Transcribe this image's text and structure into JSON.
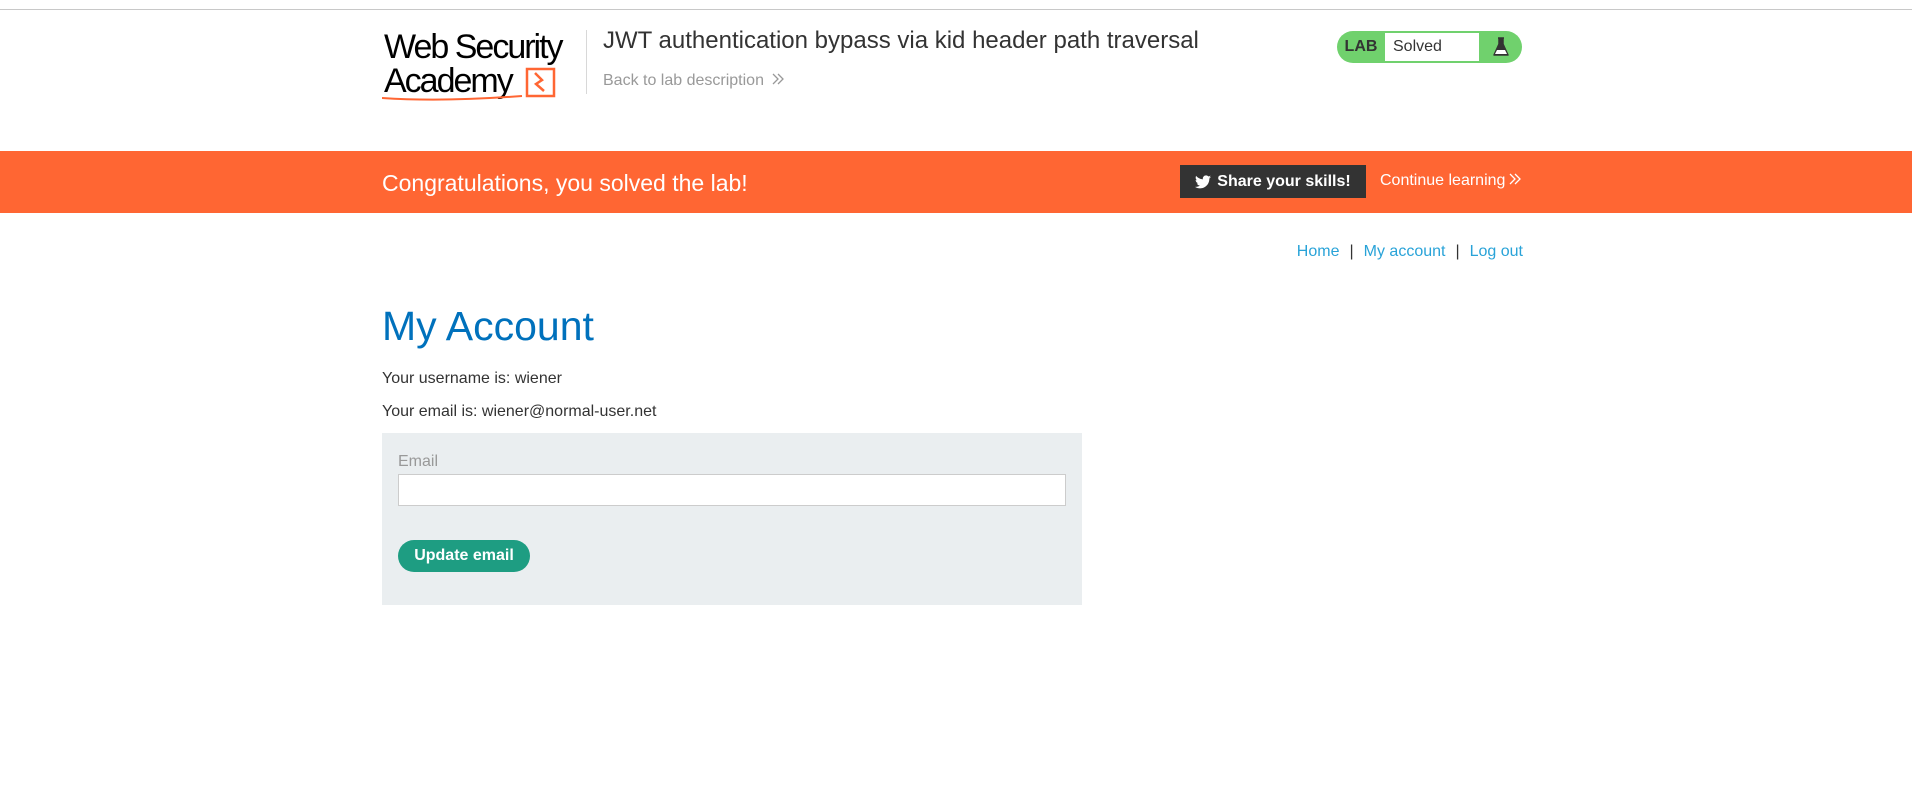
{
  "header": {
    "logo_text_line1": "Web Security",
    "logo_text_line2": "Academy",
    "lab_title": "JWT authentication bypass via kid header path traversal",
    "back_link": "Back to lab description",
    "lab_status": {
      "label": "LAB",
      "state": "Solved",
      "icon": "flask-icon"
    }
  },
  "banner": {
    "message": "Congratulations, you solved the lab!",
    "share_label": "Share your skills!",
    "share_icon": "twitter-icon",
    "continue_label": "Continue learning"
  },
  "nav": {
    "home": "Home",
    "separator": "|",
    "my_account": "My account",
    "log_out": "Log out"
  },
  "main": {
    "title": "My Account",
    "username_line": "Your username is: wiener",
    "email_line": "Your email is: wiener@normal-user.net",
    "form": {
      "email_label": "Email",
      "email_value": "",
      "update_button": "Update email"
    }
  },
  "colors": {
    "banner": "#ff6633",
    "lab_solved": "#70d16d",
    "title_blue": "#0071bc",
    "link_blue": "#29a3d8",
    "button_green": "#1e9d82",
    "form_bg": "#eaeef0"
  }
}
